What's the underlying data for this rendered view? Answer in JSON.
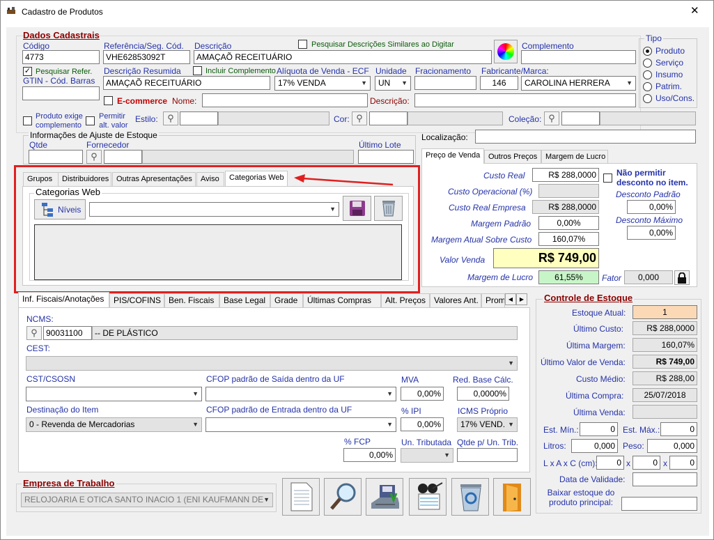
{
  "window": {
    "title": "Cadastro de Produtos",
    "close": "✕"
  },
  "dados": {
    "section": "Dados Cadastrais",
    "codigo_label": "Código",
    "codigo": "4773",
    "ref_label": "Referência/Seg. Cód.",
    "ref": "VHE62853092T",
    "desc_label": "Descrição",
    "desc": "AMAÇAÕ RECEITUÁRIO",
    "pesq_sim_label": "Pesquisar Descrições Similares ao Digitar",
    "complemento_label": "Complemento",
    "complemento": "",
    "pesq_ref_label": "Pesquisar Refer.",
    "gtin_label": "GTIN - Cód. Barras",
    "gtin": "",
    "desc_res_label": "Descrição Resumida",
    "desc_res": "AMAÇAÕ RECEITUÁRIO",
    "incluir_comp_label": "Incluir Complemento",
    "aliquota_label": "Alíquota de Venda - ECF",
    "aliquota": "17% VENDA",
    "unidade_label": "Unidade",
    "unidade": "UN",
    "fracionamento_label": "Fracionamento",
    "fracionamento": "",
    "fabricante_label": "Fabricante/Marca:",
    "fabricante_cod": "146",
    "fabricante": "CAROLINA HERRERA",
    "ecommerce_label": "E-commerce",
    "nome_label": "Nome:",
    "nome": "",
    "descricao2_label": "Descrição:",
    "descricao2": "",
    "produto_exige_label": "Produto exige complemento",
    "permitir_label": "Permitir alt. valor",
    "estilo_label": "Estilo:",
    "cor_label": "Cor:",
    "colecao_label": "Coleção:"
  },
  "tipo": {
    "label": "Tipo",
    "options": [
      "Produto",
      "Serviço",
      "Insumo",
      "Patrim.",
      "Uso/Cons."
    ],
    "selected": 0
  },
  "ajuste": {
    "label": "Informações de Ajuste de Estoque",
    "qtde_label": "Qtde",
    "fornecedor_label": "Fornecedor",
    "ultimo_lote_label": "Último Lote"
  },
  "localizacao_label": "Localização:",
  "tabs1": [
    "Grupos",
    "Distribuidores",
    "Outras Apresentações",
    "Aviso",
    "Categorias Web"
  ],
  "catweb": {
    "label": "Categorias Web",
    "niveis": "Níveis",
    "select": ""
  },
  "preco_tabs": [
    "Preço de Venda",
    "Outros Preços",
    "Margem de Lucro"
  ],
  "preco": {
    "custo_real_label": "Custo Real",
    "custo_real": "R$ 288,0000",
    "custo_op_label": "Custo Operacional (%)",
    "custo_op": "",
    "custo_real_emp_label": "Custo Real Empresa",
    "custo_real_emp": "R$ 288,0000",
    "margem_padrao_label": "Margem Padrão",
    "margem_padrao": "0,00%",
    "margem_atual_label": "Margem Atual Sobre Custo",
    "margem_atual": "160,07%",
    "valor_venda_label": "Valor Venda",
    "valor_venda": "R$ 749,00",
    "margem_lucro_label": "Margem de Lucro",
    "margem_lucro": "61,55%",
    "nao_permitir_label": "Não permitir desconto no item.",
    "desc_padrao_label": "Desconto Padrão",
    "desc_padrao": "0,00%",
    "desc_max_label": "Desconto Máximo",
    "desc_max": "0,00%",
    "fator_label": "Fator",
    "fator": "0,000"
  },
  "tabs2": [
    "Inf. Fiscais/Anotações",
    "PIS/COFINS",
    "Ben. Fiscais",
    "Base Legal",
    "Grade",
    "Últimas Compras",
    "Alt. Preços",
    "Valores Ant.",
    "Prom"
  ],
  "fiscal": {
    "ncms_label": "NCMS:",
    "ncm": "90031100",
    "ncm_desc": "-- DE PLÁSTICO",
    "cest_label": "CEST:",
    "cest": "",
    "cst_label": "CST/CSOSN",
    "cst": "",
    "cfop_saida_label": "CFOP padrão de Saída dentro da UF",
    "cfop_saida": "",
    "mva_label": "MVA",
    "mva": "0,00%",
    "red_base_label": "Red. Base Cálc.",
    "red_base": "0,0000%",
    "dest_label": "Destinação do Item",
    "dest": "0 - Revenda de Mercadorias",
    "cfop_entrada_label": "CFOP padrão de Entrada dentro da UF",
    "cfop_entrada": "",
    "ipi_label": "% IPI",
    "ipi": "0,00%",
    "icms_label": "ICMS Próprio",
    "icms": "17% VEND.",
    "fcp_label": "% FCP",
    "fcp": "0,00%",
    "un_trib_label": "Un. Tributada",
    "un_trib": "",
    "qtde_un_trib_label": "Qtde p/ Un. Trib.",
    "qtde_un_trib": ""
  },
  "estoque": {
    "label": "Controle de Estoque",
    "atual_label": "Estoque Atual:",
    "atual": "1",
    "ult_custo_label": "Último Custo:",
    "ult_custo": "R$ 288,0000",
    "ult_margem_label": "Última Margem:",
    "ult_margem": "160,07%",
    "ult_valor_label": "Último Valor de Venda:",
    "ult_valor": "R$ 749,00",
    "custo_medio_label": "Custo Médio:",
    "custo_medio": "R$ 288,00",
    "ult_compra_label": "Última Compra:",
    "ult_compra": "25/07/2018",
    "ult_venda_label": "Última Venda:",
    "ult_venda": "",
    "min_label": "Est. Mín.:",
    "min": "0",
    "max_label": "Est. Máx.:",
    "max": "0",
    "litros_label": "Litros:",
    "litros": "0,000",
    "peso_label": "Peso:",
    "peso": "0,000",
    "lxaxc_label": "L x A x C (cm):",
    "l": "0",
    "x1": "x",
    "a": "0",
    "x2": "x",
    "c": "0",
    "validade_label": "Data de Validade:",
    "validade": "",
    "baixar_label": "Baixar estoque do produto principal:",
    "baixar": ""
  },
  "empresa": {
    "label": "Empresa de Trabalho",
    "value": "RELOJOARIA E OTICA SANTO INACIO 1  (ENI KAUFMANN DE"
  },
  "colors": {
    "highlight": "#e02020",
    "valor_bg": "#ffffc0",
    "margem_bg": "#c8f5c8",
    "estoque_bg": "#fbd9b7"
  }
}
